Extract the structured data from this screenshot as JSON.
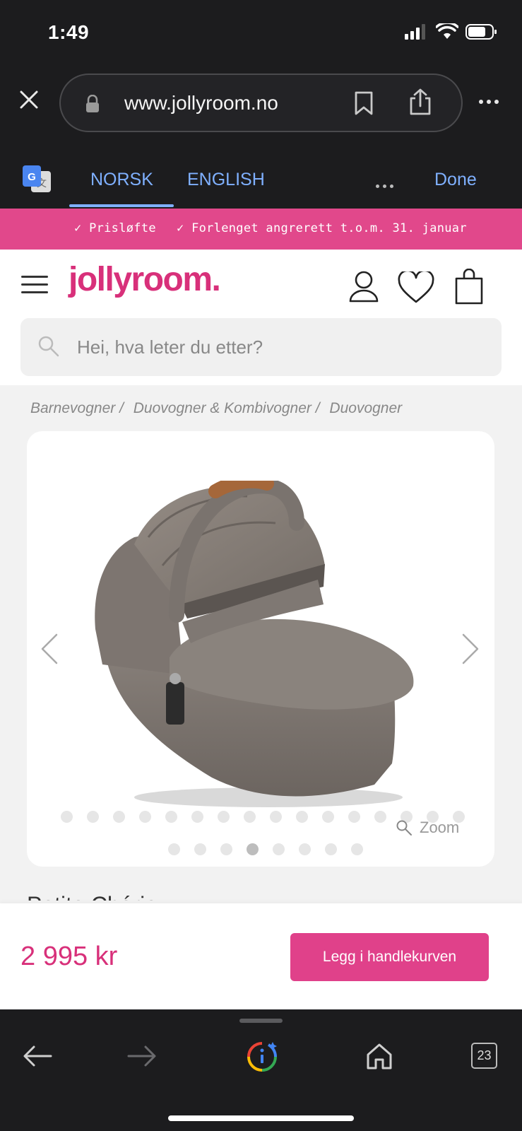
{
  "status_bar": {
    "time": "1:49"
  },
  "browser": {
    "url": "www.jollyroom.no",
    "icons": [
      "close-icon",
      "lock-icon",
      "bookmark-icon",
      "share-icon",
      "more-icon"
    ]
  },
  "translate_bar": {
    "tabs": [
      {
        "label": "NORSK",
        "selected": true
      },
      {
        "label": "ENGLISH",
        "selected": false
      }
    ],
    "done_label": "Done"
  },
  "promo": {
    "items": [
      "Prisløfte",
      "Forlenget angrerett t.o.m. 31. januar"
    ],
    "color": "#e1488b"
  },
  "header": {
    "logo_text": "jollyroom.",
    "brand_color": "#d8307a"
  },
  "search": {
    "placeholder": "Hei, hva leter du etter?"
  },
  "breadcrumb": [
    "Barnevogner /",
    "Duovogner & Kombivogner /",
    "Duovogner"
  ],
  "gallery": {
    "zoom_label": "Zoom",
    "dots_total": 24,
    "active_dot": 18
  },
  "product": {
    "title": "Petite Chérie",
    "price": "2 995 kr",
    "add_to_cart_label": "Legg i handlekurven"
  },
  "toolbar": {
    "tab_count": "23"
  }
}
